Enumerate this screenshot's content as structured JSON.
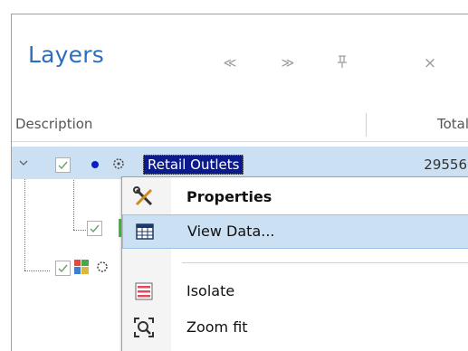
{
  "panel": {
    "title": "Layers",
    "buttons": {
      "first": "≪",
      "last": "≫",
      "pin": "⊥",
      "close": "×"
    }
  },
  "columns": {
    "description": "Description",
    "total": "Total"
  },
  "tree": {
    "rows": [
      {
        "label": "Retail Outlets",
        "total": "29556",
        "selected": true,
        "checked": true
      }
    ]
  },
  "context_menu": {
    "items": [
      {
        "label": "Properties",
        "icon": "wrench-screwdriver-icon"
      },
      {
        "label": "View Data...",
        "icon": "table-grid-icon",
        "highlighted": true
      },
      {
        "label": "Isolate",
        "icon": "isolate-list-icon"
      },
      {
        "label": "Zoom fit",
        "icon": "zoom-fit-icon"
      }
    ]
  },
  "colors": {
    "title_blue": "#2a6fbd",
    "selection_bg": "#0b1a8c",
    "row_highlight": "#cce0f4",
    "point_symbol": "#0a1fbf"
  }
}
